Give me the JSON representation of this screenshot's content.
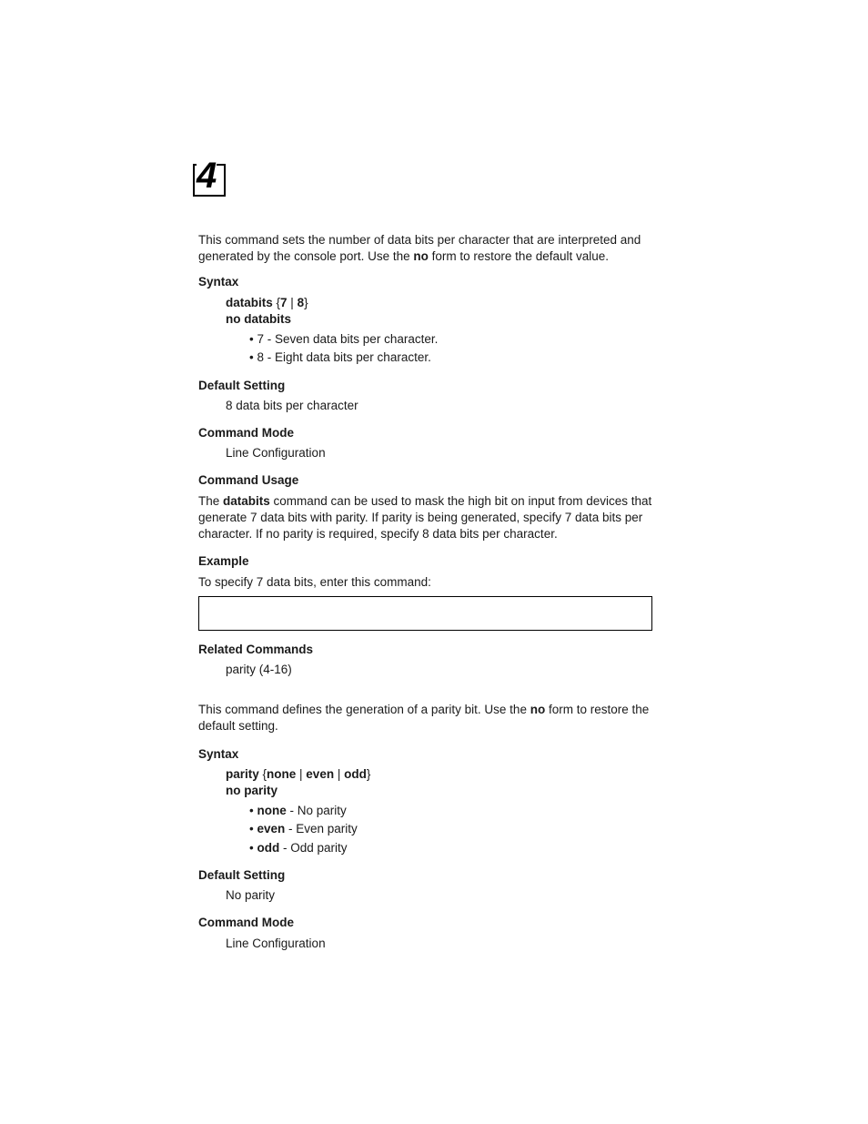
{
  "chapter": {
    "number": "4"
  },
  "databits": {
    "intro_pre": "This command sets the number of data bits per character that are interpreted and generated by the console port. Use the ",
    "intro_bold": "no",
    "intro_post": " form to restore the default value.",
    "syntax_h": "Syntax",
    "syntax_cmd_pre": "databits",
    "syntax_cmd_brace_open": " {",
    "syntax_cmd_opt1": "7",
    "syntax_cmd_pipe": " | ",
    "syntax_cmd_opt2": "8",
    "syntax_cmd_brace_close": "}",
    "syntax_no": "no databits",
    "opt7": "7 - Seven data bits per character.",
    "opt8": "8 - Eight data bits per character.",
    "default_h": "Default Setting",
    "default_v": "8 data bits per character",
    "mode_h": "Command Mode",
    "mode_v": "Line Configuration",
    "usage_h": "Command Usage",
    "usage_pre": "The ",
    "usage_bold": "databits",
    "usage_post": " command can be used to mask the high bit on input from devices that generate 7 data bits with parity. If parity is being generated, specify 7 data bits per character. If no parity is required, specify 8 data bits per character.",
    "example_h": "Example",
    "example_txt": "To specify 7 data bits, enter this command:",
    "related_h": "Related Commands",
    "related_v": "parity (4-16)"
  },
  "parity": {
    "intro_pre": "This command defines the generation of a parity bit. Use the ",
    "intro_bold": "no",
    "intro_post": " form to restore the default setting.",
    "syntax_h": "Syntax",
    "syntax_cmd_pre": "parity",
    "syntax_brace_open": " {",
    "syntax_opt_none": "none",
    "syntax_pipe1": " | ",
    "syntax_opt_even": "even",
    "syntax_pipe2": " | ",
    "syntax_opt_odd": "odd",
    "syntax_brace_close": "}",
    "syntax_no": "no parity",
    "opt_none_b": "none",
    "opt_none_t": " - No parity",
    "opt_even_b": "even",
    "opt_even_t": " - Even parity",
    "opt_odd_b": "odd",
    "opt_odd_t": " - Odd parity",
    "default_h": "Default Setting",
    "default_v": "No parity",
    "mode_h": "Command Mode",
    "mode_v": "Line Configuration"
  }
}
